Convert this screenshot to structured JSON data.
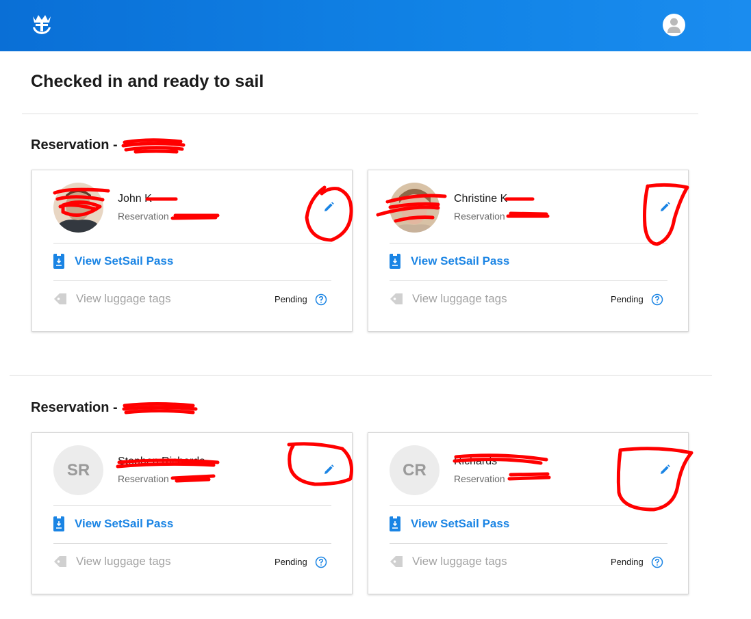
{
  "header": {
    "logo_icon": "crown-anchor-logo",
    "profile_icon": "user-icon",
    "brand_color": "#0a78e0"
  },
  "page": {
    "title": "Checked in and ready to sail"
  },
  "reservations": [
    {
      "heading": "Reservation - ",
      "guests": [
        {
          "name": "John K",
          "sub": "Reservation",
          "avatar": "photo",
          "pass_label": "View SetSail Pass",
          "luggage_label": "View luggage tags",
          "status": "Pending"
        },
        {
          "name": "Christine K",
          "sub": "Reservation",
          "avatar": "photo",
          "pass_label": "View SetSail Pass",
          "luggage_label": "View luggage tags",
          "status": "Pending"
        }
      ]
    },
    {
      "heading": "Reservation - ",
      "guests": [
        {
          "name": "Stephen Richards",
          "sub": "Reservation",
          "initials": "SR",
          "pass_label": "View SetSail Pass",
          "luggage_label": "View luggage tags",
          "status": "Pending"
        },
        {
          "name": "Richards",
          "sub": "Reservation",
          "initials": "CR",
          "pass_label": "View SetSail Pass",
          "luggage_label": "View luggage tags",
          "status": "Pending"
        }
      ]
    }
  ],
  "colors": {
    "accent": "#1a84e4",
    "muted": "#a3a3a3",
    "annotation_red": "#ff0000"
  }
}
